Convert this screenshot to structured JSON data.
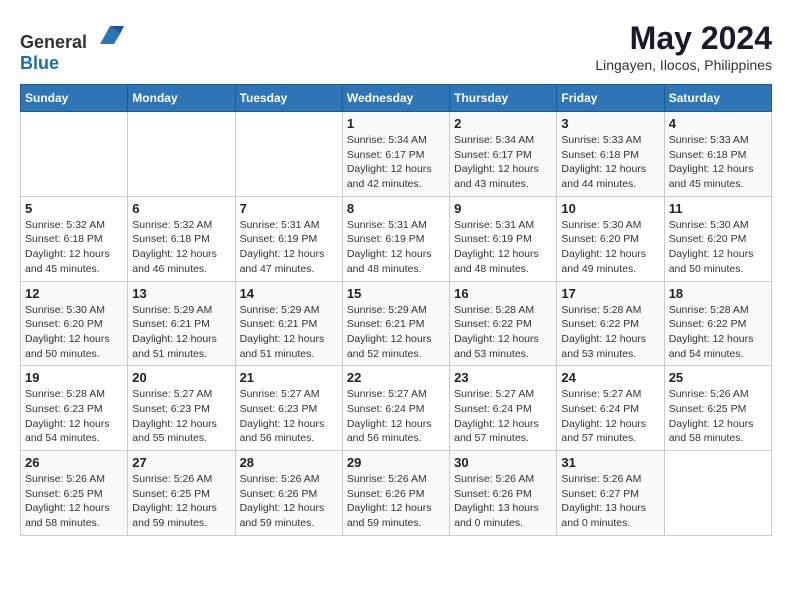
{
  "header": {
    "logo_general": "General",
    "logo_blue": "Blue",
    "month_year": "May 2024",
    "location": "Lingayen, Ilocos, Philippines"
  },
  "weekdays": [
    "Sunday",
    "Monday",
    "Tuesday",
    "Wednesday",
    "Thursday",
    "Friday",
    "Saturday"
  ],
  "weeks": [
    [
      {
        "day": "",
        "info": ""
      },
      {
        "day": "",
        "info": ""
      },
      {
        "day": "",
        "info": ""
      },
      {
        "day": "1",
        "info": "Sunrise: 5:34 AM\nSunset: 6:17 PM\nDaylight: 12 hours\nand 42 minutes."
      },
      {
        "day": "2",
        "info": "Sunrise: 5:34 AM\nSunset: 6:17 PM\nDaylight: 12 hours\nand 43 minutes."
      },
      {
        "day": "3",
        "info": "Sunrise: 5:33 AM\nSunset: 6:18 PM\nDaylight: 12 hours\nand 44 minutes."
      },
      {
        "day": "4",
        "info": "Sunrise: 5:33 AM\nSunset: 6:18 PM\nDaylight: 12 hours\nand 45 minutes."
      }
    ],
    [
      {
        "day": "5",
        "info": "Sunrise: 5:32 AM\nSunset: 6:18 PM\nDaylight: 12 hours\nand 45 minutes."
      },
      {
        "day": "6",
        "info": "Sunrise: 5:32 AM\nSunset: 6:18 PM\nDaylight: 12 hours\nand 46 minutes."
      },
      {
        "day": "7",
        "info": "Sunrise: 5:31 AM\nSunset: 6:19 PM\nDaylight: 12 hours\nand 47 minutes."
      },
      {
        "day": "8",
        "info": "Sunrise: 5:31 AM\nSunset: 6:19 PM\nDaylight: 12 hours\nand 48 minutes."
      },
      {
        "day": "9",
        "info": "Sunrise: 5:31 AM\nSunset: 6:19 PM\nDaylight: 12 hours\nand 48 minutes."
      },
      {
        "day": "10",
        "info": "Sunrise: 5:30 AM\nSunset: 6:20 PM\nDaylight: 12 hours\nand 49 minutes."
      },
      {
        "day": "11",
        "info": "Sunrise: 5:30 AM\nSunset: 6:20 PM\nDaylight: 12 hours\nand 50 minutes."
      }
    ],
    [
      {
        "day": "12",
        "info": "Sunrise: 5:30 AM\nSunset: 6:20 PM\nDaylight: 12 hours\nand 50 minutes."
      },
      {
        "day": "13",
        "info": "Sunrise: 5:29 AM\nSunset: 6:21 PM\nDaylight: 12 hours\nand 51 minutes."
      },
      {
        "day": "14",
        "info": "Sunrise: 5:29 AM\nSunset: 6:21 PM\nDaylight: 12 hours\nand 51 minutes."
      },
      {
        "day": "15",
        "info": "Sunrise: 5:29 AM\nSunset: 6:21 PM\nDaylight: 12 hours\nand 52 minutes."
      },
      {
        "day": "16",
        "info": "Sunrise: 5:28 AM\nSunset: 6:22 PM\nDaylight: 12 hours\nand 53 minutes."
      },
      {
        "day": "17",
        "info": "Sunrise: 5:28 AM\nSunset: 6:22 PM\nDaylight: 12 hours\nand 53 minutes."
      },
      {
        "day": "18",
        "info": "Sunrise: 5:28 AM\nSunset: 6:22 PM\nDaylight: 12 hours\nand 54 minutes."
      }
    ],
    [
      {
        "day": "19",
        "info": "Sunrise: 5:28 AM\nSunset: 6:23 PM\nDaylight: 12 hours\nand 54 minutes."
      },
      {
        "day": "20",
        "info": "Sunrise: 5:27 AM\nSunset: 6:23 PM\nDaylight: 12 hours\nand 55 minutes."
      },
      {
        "day": "21",
        "info": "Sunrise: 5:27 AM\nSunset: 6:23 PM\nDaylight: 12 hours\nand 56 minutes."
      },
      {
        "day": "22",
        "info": "Sunrise: 5:27 AM\nSunset: 6:24 PM\nDaylight: 12 hours\nand 56 minutes."
      },
      {
        "day": "23",
        "info": "Sunrise: 5:27 AM\nSunset: 6:24 PM\nDaylight: 12 hours\nand 57 minutes."
      },
      {
        "day": "24",
        "info": "Sunrise: 5:27 AM\nSunset: 6:24 PM\nDaylight: 12 hours\nand 57 minutes."
      },
      {
        "day": "25",
        "info": "Sunrise: 5:26 AM\nSunset: 6:25 PM\nDaylight: 12 hours\nand 58 minutes."
      }
    ],
    [
      {
        "day": "26",
        "info": "Sunrise: 5:26 AM\nSunset: 6:25 PM\nDaylight: 12 hours\nand 58 minutes."
      },
      {
        "day": "27",
        "info": "Sunrise: 5:26 AM\nSunset: 6:25 PM\nDaylight: 12 hours\nand 59 minutes."
      },
      {
        "day": "28",
        "info": "Sunrise: 5:26 AM\nSunset: 6:26 PM\nDaylight: 12 hours\nand 59 minutes."
      },
      {
        "day": "29",
        "info": "Sunrise: 5:26 AM\nSunset: 6:26 PM\nDaylight: 12 hours\nand 59 minutes."
      },
      {
        "day": "30",
        "info": "Sunrise: 5:26 AM\nSunset: 6:26 PM\nDaylight: 13 hours\nand 0 minutes."
      },
      {
        "day": "31",
        "info": "Sunrise: 5:26 AM\nSunset: 6:27 PM\nDaylight: 13 hours\nand 0 minutes."
      },
      {
        "day": "",
        "info": ""
      }
    ]
  ]
}
